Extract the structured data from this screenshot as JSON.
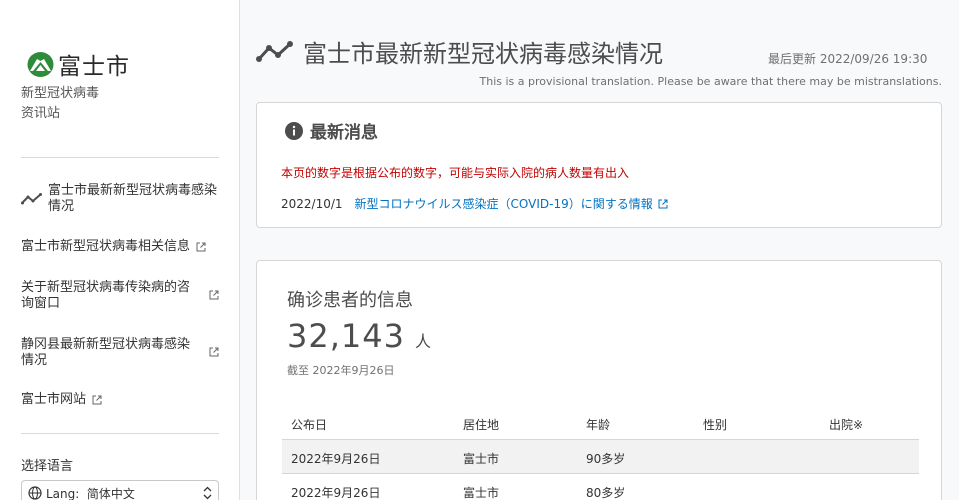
{
  "sidebar": {
    "logo_name": "富士市",
    "subtitle_line1": "新型冠状病毒",
    "subtitle_line2": "资讯站",
    "nav": [
      {
        "label": "富士市最新新型冠状病毒感染情况",
        "icon": "trend-icon"
      },
      {
        "label": "富士市新型冠状病毒相关信息",
        "icon": "external-link-icon"
      },
      {
        "label": "关于新型冠状病毒传染病的咨询窗口",
        "icon": "external-link-icon"
      },
      {
        "label": "静冈县最新新型冠状病毒感染情况",
        "icon": "external-link-icon"
      },
      {
        "label": "富士市网站",
        "icon": "external-link-icon"
      }
    ],
    "language_title": "选择语言",
    "language_select": "Lang:  简体中文"
  },
  "header": {
    "title": "富士市最新新型冠状病毒感染情况",
    "last_updated": "最后更新 2022/09/26 19:30",
    "translation_note": "This is a provisional translation. Please be aware that there may be mistranslations."
  },
  "news": {
    "heading": "最新消息",
    "alert": "本页的数字是根据公布的数字，可能与实际入院的病人数量有出入",
    "items": [
      {
        "date": "2022/10/1",
        "link": "新型コロナウイルス感染症（COVID-19）に関する情報"
      }
    ]
  },
  "patients": {
    "title": "确诊患者的信息",
    "count": "32,143",
    "unit": "人",
    "as_of": "截至 2022年9月26日",
    "columns": [
      "公布日",
      "居住地",
      "年龄",
      "性别",
      "出院※"
    ],
    "rows": [
      [
        "2022年9月26日",
        "富士市",
        "90多岁",
        "",
        ""
      ],
      [
        "2022年9月26日",
        "富士市",
        "80多岁",
        "",
        ""
      ]
    ]
  },
  "colors": {
    "link": "#0071c2",
    "alert": "#c40000",
    "logo_green": "#2e8b3a"
  }
}
